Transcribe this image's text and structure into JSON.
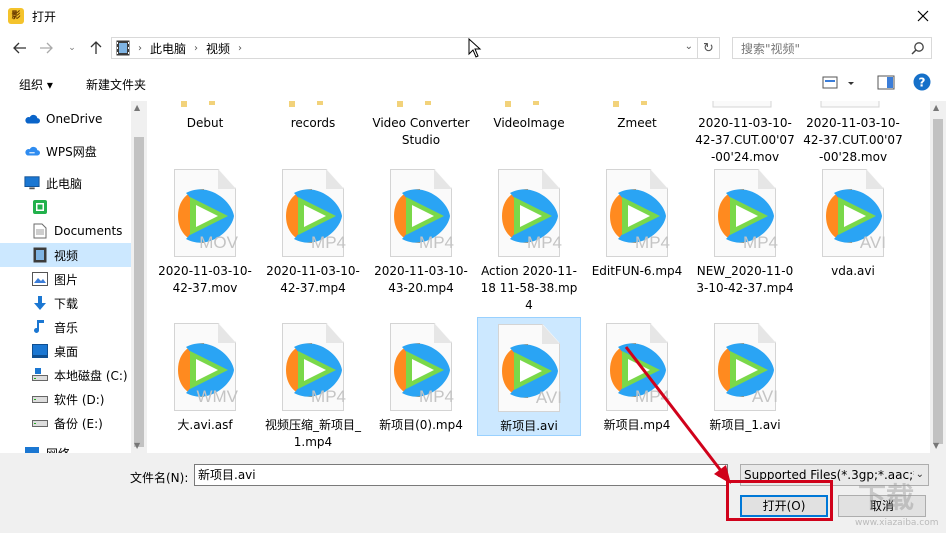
{
  "window": {
    "title": "打开",
    "app_icon_text": "影"
  },
  "address": {
    "crumbs": [
      "此电脑",
      "视频"
    ]
  },
  "search": {
    "placeholder": "搜索\"视频\""
  },
  "toolbar": {
    "organize": "组织 ▾",
    "new_folder": "新建文件夹"
  },
  "sidebar": {
    "items": [
      {
        "label": "OneDrive",
        "icon": "cloud-icon"
      },
      {
        "label": "WPS网盘",
        "icon": "wps-cloud-icon"
      },
      {
        "label": "此电脑",
        "icon": "computer-icon"
      },
      {
        "label": "",
        "icon": "green-app-icon"
      },
      {
        "label": "Documents",
        "icon": "documents-icon"
      },
      {
        "label": "视频",
        "icon": "video-icon",
        "selected": true
      },
      {
        "label": "图片",
        "icon": "pictures-icon"
      },
      {
        "label": "下载",
        "icon": "download-icon"
      },
      {
        "label": "音乐",
        "icon": "music-icon"
      },
      {
        "label": "桌面",
        "icon": "desktop-icon"
      },
      {
        "label": "本地磁盘 (C:)",
        "icon": "drive-icon"
      },
      {
        "label": "软件 (D:)",
        "icon": "drive-icon"
      },
      {
        "label": "备份 (E:)",
        "icon": "drive-icon"
      },
      {
        "label": "网络",
        "icon": "network-icon"
      }
    ]
  },
  "files": {
    "row1": [
      {
        "name": "Debut",
        "type": "folder"
      },
      {
        "name": "records",
        "type": "folder"
      },
      {
        "name": "Video Converter Studio",
        "type": "folder"
      },
      {
        "name": "VideoImage",
        "type": "folder"
      },
      {
        "name": "Zmeet",
        "type": "folder"
      },
      {
        "name": "2020-11-03-10-42-37.CUT.00'07-00'24.mov",
        "type": "file"
      },
      {
        "name": "2020-11-03-10-42-37.CUT.00'07-00'28.mov",
        "type": "file"
      }
    ],
    "row2": [
      {
        "name": "2020-11-03-10-42-37.mov",
        "ext": "MOV"
      },
      {
        "name": "2020-11-03-10-42-37.mp4",
        "ext": "MP4"
      },
      {
        "name": "2020-11-03-10-43-20.mp4",
        "ext": "MP4"
      },
      {
        "name": "Action 2020-11-18 11-58-38.mp4",
        "ext": "MP4"
      },
      {
        "name": "EditFUN-6.mp4",
        "ext": "MP4"
      },
      {
        "name": "NEW_2020-11-03-10-42-37.mp4",
        "ext": "MP4"
      },
      {
        "name": "vda.avi",
        "ext": "AVI"
      }
    ],
    "row3": [
      {
        "name": "大.avi.asf",
        "ext": "WMV"
      },
      {
        "name": "视频压缩_新项目_1.mp4",
        "ext": "MP4"
      },
      {
        "name": "新项目(0).mp4",
        "ext": "MP4"
      },
      {
        "name": "新项目.avi",
        "ext": "AVI",
        "selected": true
      },
      {
        "name": "新项目.mp4",
        "ext": "MP4"
      },
      {
        "name": "新项目_1.avi",
        "ext": "AVI"
      }
    ]
  },
  "bottom": {
    "filename_label": "文件名(N):",
    "filename_value": "新项目.avi",
    "filetype_value": "Supported Files(*.3gp;*.aac;*",
    "open_label": "打开(O)",
    "cancel_label": "取消"
  },
  "watermark": {
    "text": "下载",
    "sub": "www.xiazaiba.com"
  },
  "colors": {
    "selection": "#cce8ff",
    "accent": "#0078d7",
    "annotation": "#d0021b"
  }
}
